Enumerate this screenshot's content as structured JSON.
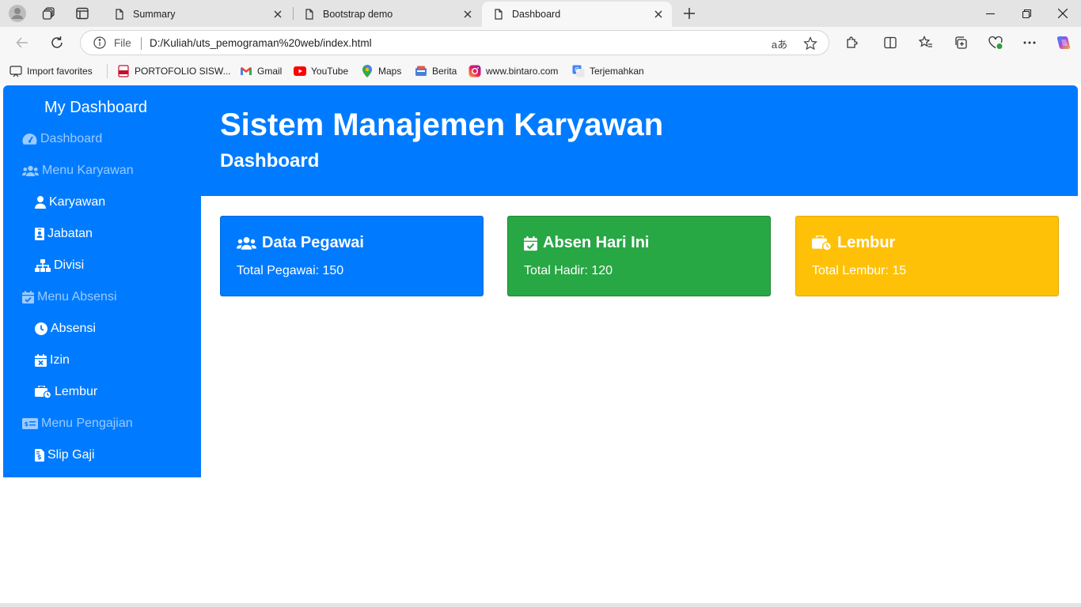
{
  "browser": {
    "tabs": [
      {
        "title": "Summary",
        "active": false
      },
      {
        "title": "Bootstrap demo",
        "active": false
      },
      {
        "title": "Dashboard",
        "active": true
      }
    ],
    "address": {
      "scheme": "File",
      "url": "D:/Kuliah/uts_pemograman%20web/index.html"
    },
    "read_aloud_glyph": "aあ",
    "favorites": [
      {
        "label": "Import favorites",
        "icon": "import-icon"
      },
      {
        "label": "PORTOFOLIO SISW...",
        "icon": "pdf-icon"
      },
      {
        "label": "Gmail",
        "icon": "gmail-icon"
      },
      {
        "label": "YouTube",
        "icon": "youtube-icon"
      },
      {
        "label": "Maps",
        "icon": "maps-icon"
      },
      {
        "label": "Berita",
        "icon": "news-icon"
      },
      {
        "label": "www.bintaro.com",
        "icon": "instagram-icon"
      },
      {
        "label": "Terjemahkan",
        "icon": "translate-icon"
      }
    ]
  },
  "sidebar": {
    "brand": "My Dashboard",
    "items": [
      {
        "label": "Dashboard",
        "icon": "tachometer-icon",
        "level": "head"
      },
      {
        "label": "Menu Karyawan",
        "icon": "users-icon",
        "level": "head"
      },
      {
        "label": "Karyawan",
        "icon": "user-icon",
        "level": "sub"
      },
      {
        "label": "Jabatan",
        "icon": "id-badge-icon",
        "level": "sub"
      },
      {
        "label": "Divisi",
        "icon": "sitemap-icon",
        "level": "sub"
      },
      {
        "label": "Menu Absensi",
        "icon": "calendar-check-icon",
        "level": "head"
      },
      {
        "label": "Absensi",
        "icon": "clock-icon",
        "level": "sub"
      },
      {
        "label": "Izin",
        "icon": "calendar-times-icon",
        "level": "sub"
      },
      {
        "label": "Lembur",
        "icon": "business-time-icon",
        "level": "sub"
      },
      {
        "label": "Menu Pengajian",
        "icon": "money-check-icon",
        "level": "head"
      },
      {
        "label": "Slip Gaji",
        "icon": "file-invoice-dollar-icon",
        "level": "sub"
      }
    ]
  },
  "header": {
    "title": "Sistem Manajemen Karyawan",
    "subtitle": "Dashboard"
  },
  "cards": [
    {
      "title": "Data Pegawai",
      "text": "Total Pegawai: 150",
      "icon": "users-icon",
      "color": "#007bff"
    },
    {
      "title": "Absen Hari Ini",
      "text": "Total Hadir: 120",
      "icon": "calendar-check-icon",
      "color": "#28a745"
    },
    {
      "title": "Lembur",
      "text": "Total Lembur: 15",
      "icon": "business-time-icon",
      "color": "#ffc107"
    }
  ],
  "colors": {
    "primary": "#007bff",
    "success": "#28a745",
    "warning": "#ffc107",
    "sidebar_heading": "#9ccaff"
  }
}
